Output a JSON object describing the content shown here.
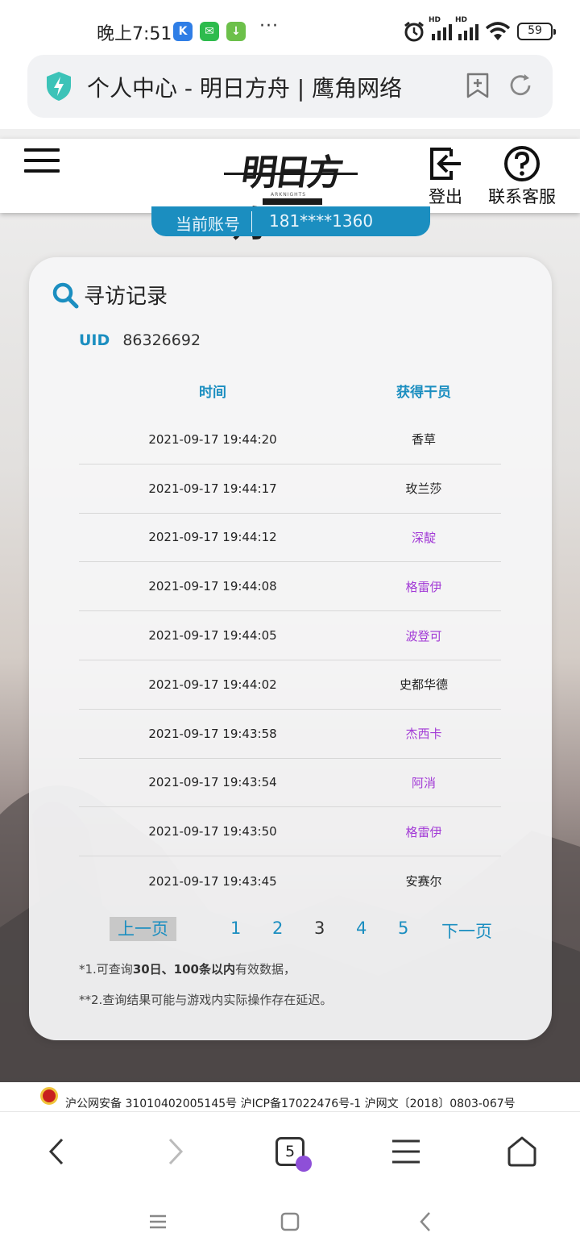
{
  "status_bar": {
    "time": "晚上7:51",
    "battery": "59",
    "dots": "···",
    "network_label": "HD"
  },
  "url_bar": {
    "title": "个人中心 - 明日方舟 | 鹰角网络"
  },
  "site_header": {
    "logo_text": "明日方舟",
    "logo_sub": "ARKNIGHTS",
    "logout_label": "登出",
    "support_label": "联系客服"
  },
  "account": {
    "label": "当前账号",
    "value": "181****1360"
  },
  "records": {
    "title": "寻访记录",
    "uid_label": "UID",
    "uid_value": "86326692",
    "columns": [
      "时间",
      "获得干员"
    ],
    "rows": [
      {
        "time": "2021-09-17 19:44:20",
        "operator": "香草",
        "highlight": false
      },
      {
        "time": "2021-09-17 19:44:17",
        "operator": "玫兰莎",
        "highlight": false
      },
      {
        "time": "2021-09-17 19:44:12",
        "operator": "深靛",
        "highlight": true
      },
      {
        "time": "2021-09-17 19:44:08",
        "operator": "格雷伊",
        "highlight": true
      },
      {
        "time": "2021-09-17 19:44:05",
        "operator": "波登可",
        "highlight": true
      },
      {
        "time": "2021-09-17 19:44:02",
        "operator": "史都华德",
        "highlight": false
      },
      {
        "time": "2021-09-17 19:43:58",
        "operator": "杰西卡",
        "highlight": true
      },
      {
        "time": "2021-09-17 19:43:54",
        "operator": "阿消",
        "highlight": true
      },
      {
        "time": "2021-09-17 19:43:50",
        "operator": "格雷伊",
        "highlight": true
      },
      {
        "time": "2021-09-17 19:43:45",
        "operator": "安赛尔",
        "highlight": false
      }
    ],
    "pager": {
      "prev": "上一页",
      "pages": [
        "1",
        "2",
        "3",
        "4",
        "5"
      ],
      "current": "3",
      "next": "下一页"
    },
    "note1_pre": "*1.可查询",
    "note1_bold": "30日、100条以内",
    "note1_post": "有效数据，",
    "note2": "**2.查询结果可能与游戏内实际操作存在延迟。"
  },
  "footer": {
    "icp": "沪公网安备 31010402005145号  沪ICP备17022476号-1  沪网文〔2018〕0803-067号"
  },
  "bottom_nav": {
    "tab_count": "5"
  },
  "colors": {
    "accent": "#1b8ec0",
    "highlight_operator": "#a23ad6",
    "shield": "#3cc3b8"
  }
}
